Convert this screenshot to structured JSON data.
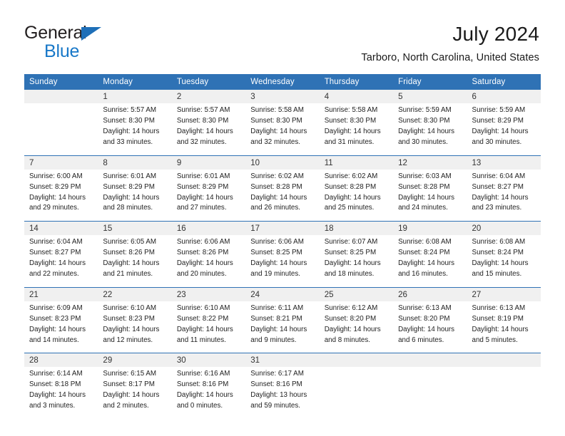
{
  "brand": {
    "name_primary": "General",
    "name_secondary": "Blue",
    "triangle_color": "#1e6fb8",
    "secondary_color": "#1878c8"
  },
  "header": {
    "title": "July 2024",
    "location": "Tarboro, North Carolina, United States"
  },
  "theme": {
    "header_blue": "#2f72b5",
    "daynum_band": "#f0f0f0",
    "text": "#222222"
  },
  "calendar": {
    "weekday_headers": [
      "Sunday",
      "Monday",
      "Tuesday",
      "Wednesday",
      "Thursday",
      "Friday",
      "Saturday"
    ],
    "weeks": [
      [
        {
          "day": "",
          "lines": []
        },
        {
          "day": "1",
          "lines": [
            "Sunrise: 5:57 AM",
            "Sunset: 8:30 PM",
            "Daylight: 14 hours",
            "and 33 minutes."
          ]
        },
        {
          "day": "2",
          "lines": [
            "Sunrise: 5:57 AM",
            "Sunset: 8:30 PM",
            "Daylight: 14 hours",
            "and 32 minutes."
          ]
        },
        {
          "day": "3",
          "lines": [
            "Sunrise: 5:58 AM",
            "Sunset: 8:30 PM",
            "Daylight: 14 hours",
            "and 32 minutes."
          ]
        },
        {
          "day": "4",
          "lines": [
            "Sunrise: 5:58 AM",
            "Sunset: 8:30 PM",
            "Daylight: 14 hours",
            "and 31 minutes."
          ]
        },
        {
          "day": "5",
          "lines": [
            "Sunrise: 5:59 AM",
            "Sunset: 8:30 PM",
            "Daylight: 14 hours",
            "and 30 minutes."
          ]
        },
        {
          "day": "6",
          "lines": [
            "Sunrise: 5:59 AM",
            "Sunset: 8:29 PM",
            "Daylight: 14 hours",
            "and 30 minutes."
          ]
        }
      ],
      [
        {
          "day": "7",
          "lines": [
            "Sunrise: 6:00 AM",
            "Sunset: 8:29 PM",
            "Daylight: 14 hours",
            "and 29 minutes."
          ]
        },
        {
          "day": "8",
          "lines": [
            "Sunrise: 6:01 AM",
            "Sunset: 8:29 PM",
            "Daylight: 14 hours",
            "and 28 minutes."
          ]
        },
        {
          "day": "9",
          "lines": [
            "Sunrise: 6:01 AM",
            "Sunset: 8:29 PM",
            "Daylight: 14 hours",
            "and 27 minutes."
          ]
        },
        {
          "day": "10",
          "lines": [
            "Sunrise: 6:02 AM",
            "Sunset: 8:28 PM",
            "Daylight: 14 hours",
            "and 26 minutes."
          ]
        },
        {
          "day": "11",
          "lines": [
            "Sunrise: 6:02 AM",
            "Sunset: 8:28 PM",
            "Daylight: 14 hours",
            "and 25 minutes."
          ]
        },
        {
          "day": "12",
          "lines": [
            "Sunrise: 6:03 AM",
            "Sunset: 8:28 PM",
            "Daylight: 14 hours",
            "and 24 minutes."
          ]
        },
        {
          "day": "13",
          "lines": [
            "Sunrise: 6:04 AM",
            "Sunset: 8:27 PM",
            "Daylight: 14 hours",
            "and 23 minutes."
          ]
        }
      ],
      [
        {
          "day": "14",
          "lines": [
            "Sunrise: 6:04 AM",
            "Sunset: 8:27 PM",
            "Daylight: 14 hours",
            "and 22 minutes."
          ]
        },
        {
          "day": "15",
          "lines": [
            "Sunrise: 6:05 AM",
            "Sunset: 8:26 PM",
            "Daylight: 14 hours",
            "and 21 minutes."
          ]
        },
        {
          "day": "16",
          "lines": [
            "Sunrise: 6:06 AM",
            "Sunset: 8:26 PM",
            "Daylight: 14 hours",
            "and 20 minutes."
          ]
        },
        {
          "day": "17",
          "lines": [
            "Sunrise: 6:06 AM",
            "Sunset: 8:25 PM",
            "Daylight: 14 hours",
            "and 19 minutes."
          ]
        },
        {
          "day": "18",
          "lines": [
            "Sunrise: 6:07 AM",
            "Sunset: 8:25 PM",
            "Daylight: 14 hours",
            "and 18 minutes."
          ]
        },
        {
          "day": "19",
          "lines": [
            "Sunrise: 6:08 AM",
            "Sunset: 8:24 PM",
            "Daylight: 14 hours",
            "and 16 minutes."
          ]
        },
        {
          "day": "20",
          "lines": [
            "Sunrise: 6:08 AM",
            "Sunset: 8:24 PM",
            "Daylight: 14 hours",
            "and 15 minutes."
          ]
        }
      ],
      [
        {
          "day": "21",
          "lines": [
            "Sunrise: 6:09 AM",
            "Sunset: 8:23 PM",
            "Daylight: 14 hours",
            "and 14 minutes."
          ]
        },
        {
          "day": "22",
          "lines": [
            "Sunrise: 6:10 AM",
            "Sunset: 8:23 PM",
            "Daylight: 14 hours",
            "and 12 minutes."
          ]
        },
        {
          "day": "23",
          "lines": [
            "Sunrise: 6:10 AM",
            "Sunset: 8:22 PM",
            "Daylight: 14 hours",
            "and 11 minutes."
          ]
        },
        {
          "day": "24",
          "lines": [
            "Sunrise: 6:11 AM",
            "Sunset: 8:21 PM",
            "Daylight: 14 hours",
            "and 9 minutes."
          ]
        },
        {
          "day": "25",
          "lines": [
            "Sunrise: 6:12 AM",
            "Sunset: 8:20 PM",
            "Daylight: 14 hours",
            "and 8 minutes."
          ]
        },
        {
          "day": "26",
          "lines": [
            "Sunrise: 6:13 AM",
            "Sunset: 8:20 PM",
            "Daylight: 14 hours",
            "and 6 minutes."
          ]
        },
        {
          "day": "27",
          "lines": [
            "Sunrise: 6:13 AM",
            "Sunset: 8:19 PM",
            "Daylight: 14 hours",
            "and 5 minutes."
          ]
        }
      ],
      [
        {
          "day": "28",
          "lines": [
            "Sunrise: 6:14 AM",
            "Sunset: 8:18 PM",
            "Daylight: 14 hours",
            "and 3 minutes."
          ]
        },
        {
          "day": "29",
          "lines": [
            "Sunrise: 6:15 AM",
            "Sunset: 8:17 PM",
            "Daylight: 14 hours",
            "and 2 minutes."
          ]
        },
        {
          "day": "30",
          "lines": [
            "Sunrise: 6:16 AM",
            "Sunset: 8:16 PM",
            "Daylight: 14 hours",
            "and 0 minutes."
          ]
        },
        {
          "day": "31",
          "lines": [
            "Sunrise: 6:17 AM",
            "Sunset: 8:16 PM",
            "Daylight: 13 hours",
            "and 59 minutes."
          ]
        },
        {
          "day": "",
          "lines": []
        },
        {
          "day": "",
          "lines": []
        },
        {
          "day": "",
          "lines": []
        }
      ]
    ]
  }
}
